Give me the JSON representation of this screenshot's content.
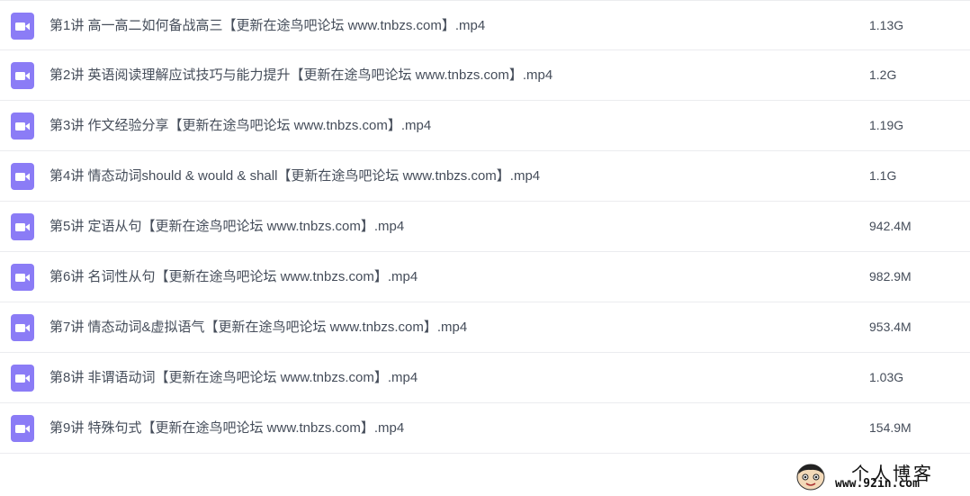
{
  "files": [
    {
      "name": "第1讲 高一高二如何备战高三【更新在途鸟吧论坛 www.tnbzs.com】.mp4",
      "size": "1.13G",
      "icon": "video-icon"
    },
    {
      "name": "第2讲 英语阅读理解应试技巧与能力提升【更新在途鸟吧论坛 www.tnbzs.com】.mp4",
      "size": "1.2G",
      "icon": "video-icon"
    },
    {
      "name": "第3讲 作文经验分享【更新在途鸟吧论坛 www.tnbzs.com】.mp4",
      "size": "1.19G",
      "icon": "video-icon"
    },
    {
      "name": "第4讲 情态动词should & would & shall【更新在途鸟吧论坛 www.tnbzs.com】.mp4",
      "size": "1.1G",
      "icon": "video-icon"
    },
    {
      "name": "第5讲 定语从句【更新在途鸟吧论坛 www.tnbzs.com】.mp4",
      "size": "942.4M",
      "icon": "video-icon"
    },
    {
      "name": "第6讲 名词性从句【更新在途鸟吧论坛 www.tnbzs.com】.mp4",
      "size": "982.9M",
      "icon": "video-icon"
    },
    {
      "name": "第7讲 情态动词&虚拟语气【更新在途鸟吧论坛 www.tnbzs.com】.mp4",
      "size": "953.4M",
      "icon": "video-icon"
    },
    {
      "name": "第8讲 非谓语动词【更新在途鸟吧论坛 www.tnbzs.com】.mp4",
      "size": "1.03G",
      "icon": "video-icon"
    },
    {
      "name": "第9讲 特殊句式【更新在途鸟吧论坛 www.tnbzs.com】.mp4",
      "size": "154.9M",
      "icon": "video-icon"
    }
  ],
  "watermark": {
    "title": "个人博客",
    "url": "www.92in.com"
  },
  "colors": {
    "icon": "#8b7cf6",
    "text": "#454d5a",
    "divider": "#ebecef"
  }
}
